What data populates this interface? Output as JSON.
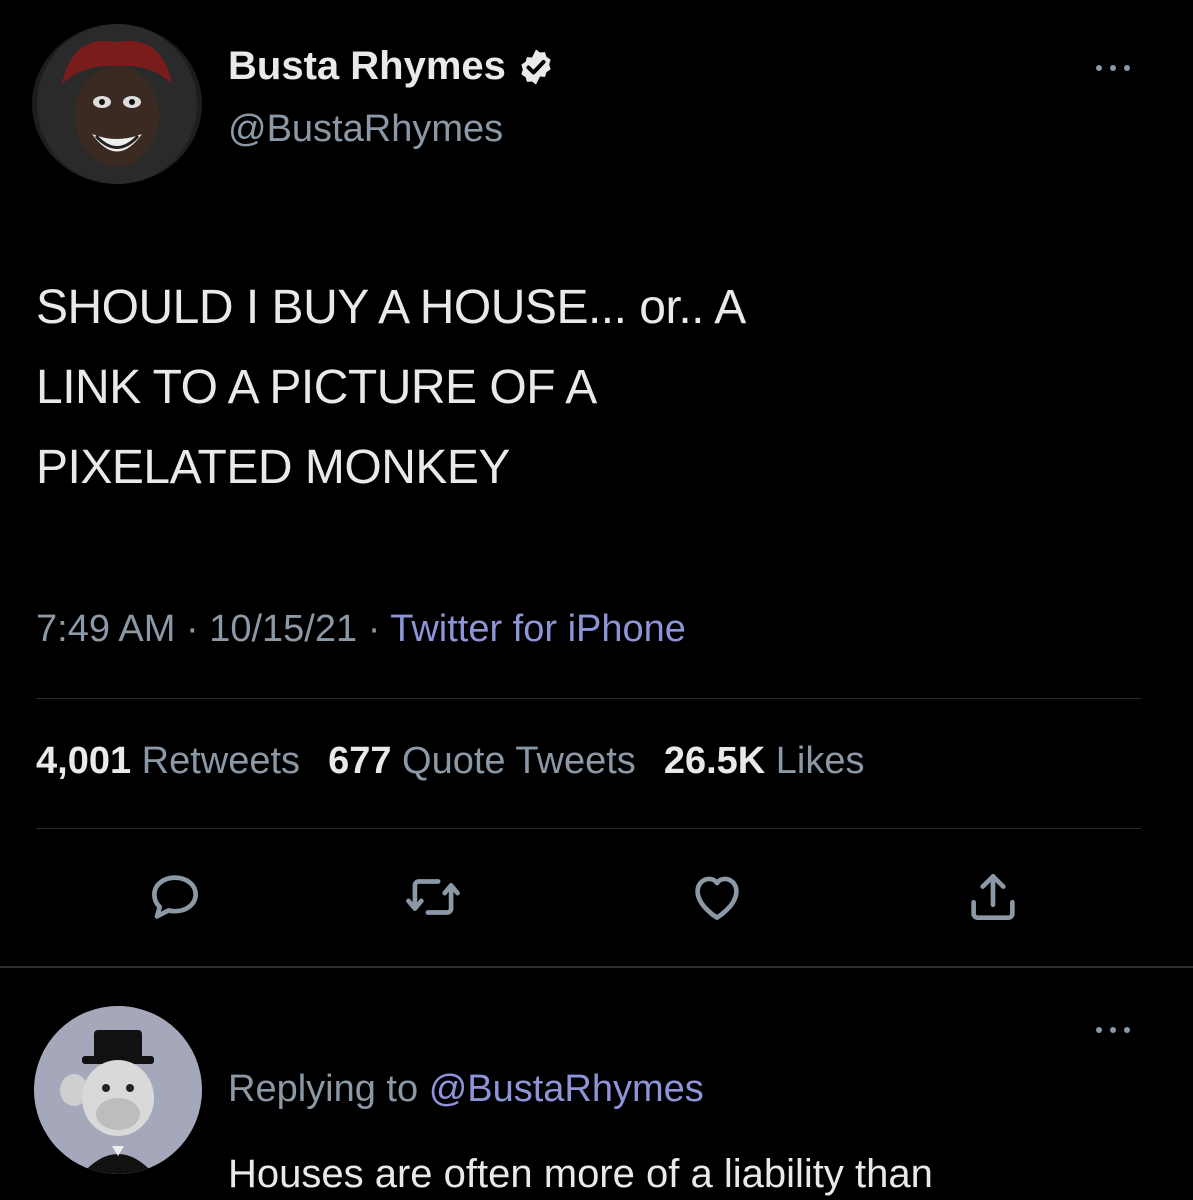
{
  "tweet": {
    "author": {
      "display_name": "Busta Rhymes",
      "handle": "@BustaRhymes",
      "verified": true
    },
    "text_lines": [
      "SHOULD I BUY A HOUSE... or.. A",
      "LINK TO A PICTURE OF A",
      "PIXELATED MONKEY"
    ],
    "time": "7:49 AM",
    "date": "10/15/21",
    "separator": "·",
    "source": "Twitter for iPhone",
    "stats": {
      "retweets_count": "4,001",
      "retweets_label": "Retweets",
      "quotes_count": "677",
      "quotes_label": "Quote Tweets",
      "likes_count": "26.5K",
      "likes_label": "Likes"
    },
    "actions": [
      "reply-icon",
      "retweet-icon",
      "like-icon",
      "share-icon"
    ]
  },
  "reply": {
    "replying_prefix": "Replying to",
    "replying_to": "@BustaRhymes",
    "text": "Houses are often more of a liability than"
  },
  "colors": {
    "background": "#000000",
    "text_primary": "#e7e9ea",
    "text_secondary": "#8b98a5",
    "link": "#8e94d8",
    "divider": "#2a2d31"
  }
}
